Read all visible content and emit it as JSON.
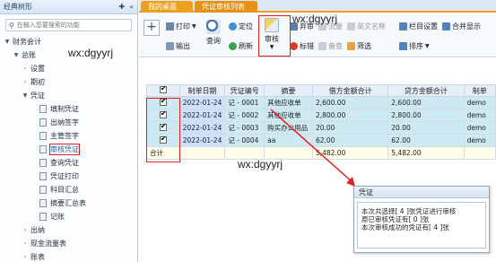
{
  "sidebar": {
    "title": "经典树形",
    "search_placeholder": "在输入您要搜索的功能",
    "items": [
      {
        "label": "财务会计",
        "arrow": "▼",
        "indent": 0,
        "doc": false
      },
      {
        "label": "总账",
        "arrow": "▼",
        "indent": 1,
        "doc": false
      },
      {
        "label": "设置",
        "arrow": "›",
        "indent": 2,
        "doc": false
      },
      {
        "label": "期初",
        "arrow": "›",
        "indent": 2,
        "doc": false
      },
      {
        "label": "凭证",
        "arrow": "▼",
        "indent": 2,
        "doc": false
      },
      {
        "label": "填制凭证",
        "arrow": "",
        "indent": 3,
        "doc": true
      },
      {
        "label": "出纳签字",
        "arrow": "",
        "indent": 3,
        "doc": true
      },
      {
        "label": "主管签字",
        "arrow": "",
        "indent": 3,
        "doc": true
      },
      {
        "label": "审核凭证",
        "arrow": "",
        "indent": 3,
        "doc": true,
        "highlight": true
      },
      {
        "label": "查询凭证",
        "arrow": "",
        "indent": 3,
        "doc": true
      },
      {
        "label": "凭证打印",
        "arrow": "",
        "indent": 3,
        "doc": true
      },
      {
        "label": "科目汇总",
        "arrow": "",
        "indent": 3,
        "doc": true
      },
      {
        "label": "摘要汇总表",
        "arrow": "",
        "indent": 3,
        "doc": true
      },
      {
        "label": "记账",
        "arrow": "",
        "indent": 3,
        "doc": true
      },
      {
        "label": "出纳",
        "arrow": "›",
        "indent": 2,
        "doc": false
      },
      {
        "label": "现金流量表",
        "arrow": "›",
        "indent": 2,
        "doc": false
      },
      {
        "label": "账表",
        "arrow": "›",
        "indent": 2,
        "doc": false
      }
    ]
  },
  "watermark": "wx:dgyyrj",
  "tabs": [
    {
      "label": "我的桌面"
    },
    {
      "label": "凭证审核列表",
      "close": "×"
    }
  ],
  "toolbar": {
    "print": "打印",
    "print_caret": "▼",
    "export": "输出",
    "query": "查询",
    "locate": "定位",
    "refresh": "刷新",
    "audit": "审核",
    "unaudit": "弃审",
    "mark": "标错",
    "flow": "流量",
    "check": "备查",
    "english": "英文名称",
    "filter": "筛选",
    "column_settings": "栏目设置",
    "sort": "排序",
    "merge": "合并显示"
  },
  "grid": {
    "headers": [
      "✔",
      "制单日期",
      "凭证编号",
      "摘要",
      "借方金额合计",
      "贷方金额合计",
      "制单"
    ],
    "rows": [
      {
        "date": "2022-01-24",
        "no": "记 - 0001",
        "summary": "其他应收单",
        "debit": "2,600.00",
        "credit": "2,600.00",
        "maker": "demo"
      },
      {
        "date": "2022-01-24",
        "no": "记 - 0002",
        "summary": "其他应收单",
        "debit": "2,800.00",
        "credit": "2,800.00",
        "maker": "demo"
      },
      {
        "date": "2022-01-24",
        "no": "记 - 0003",
        "summary": "购买办公用品",
        "debit": "20.00",
        "credit": "20.00",
        "maker": "demo"
      },
      {
        "date": "2022-01-24",
        "no": "记 - 0004",
        "summary": "aa",
        "debit": "62.00",
        "credit": "62.00",
        "maker": "demo"
      }
    ],
    "total_label": "合计",
    "total_debit": "5,482.00",
    "total_credit": "5,482.00"
  },
  "dialog": {
    "title": "凭证",
    "line1": "本次共选择[ 4 ]张凭证进行审核",
    "line2": "原已审核凭证有[ 0 ]张",
    "line3": "本次审核成功的凭证有[ 4 ]张"
  }
}
